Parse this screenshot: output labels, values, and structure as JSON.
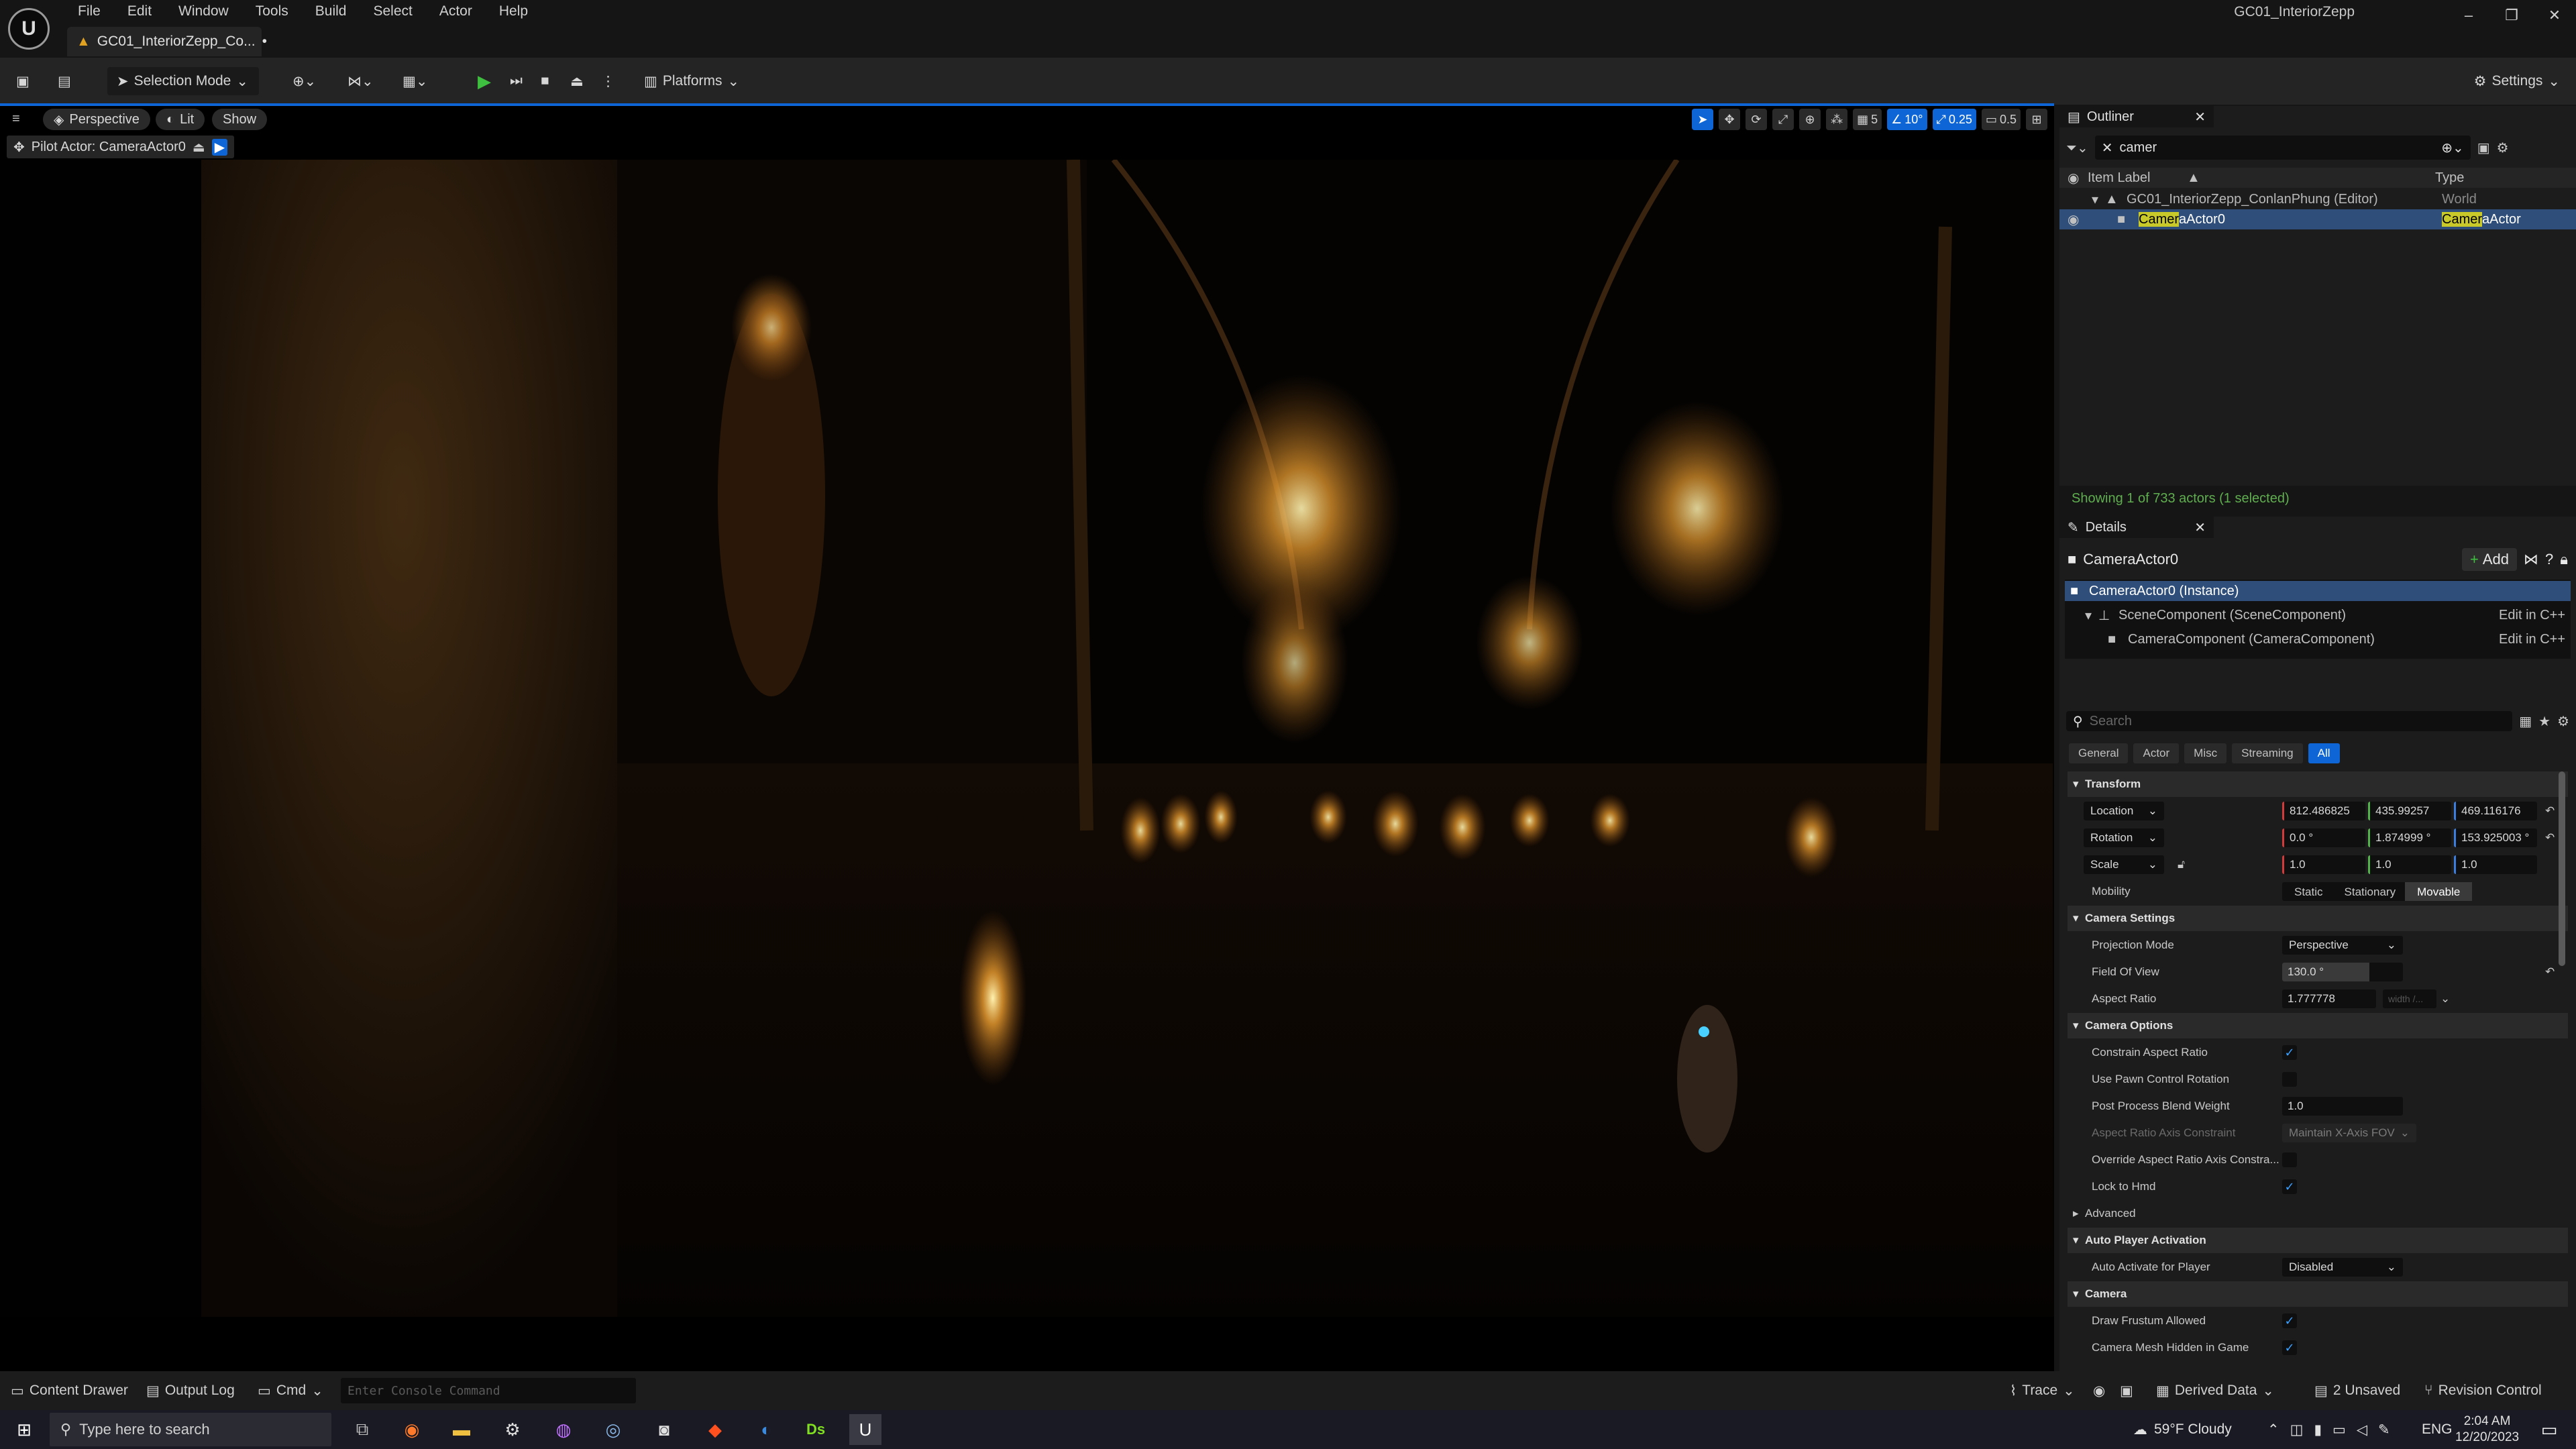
{
  "app": {
    "window_title": "GC01_InteriorZepp",
    "doc_tab": "GC01_InteriorZepp_Co...",
    "menus": [
      "File",
      "Edit",
      "Window",
      "Tools",
      "Build",
      "Select",
      "Actor",
      "Help"
    ]
  },
  "toolbar": {
    "selection_mode": "Selection Mode",
    "platforms": "Platforms",
    "settings": "Settings"
  },
  "viewport": {
    "perspective": "Perspective",
    "lit": "Lit",
    "show": "Show",
    "pilot_actor": "Pilot Actor: CameraActor0",
    "grid_snap": "5",
    "angle_snap": "10°",
    "scale_snap": "0.25",
    "camera_speed": "0.5"
  },
  "outliner": {
    "title": "Outliner",
    "search_value": "camer",
    "col_item_label": "Item Label",
    "col_type": "Type",
    "world_row": {
      "label": "GC01_InteriorZepp_ConlanPhung (Editor)",
      "type": "World"
    },
    "actor_row": {
      "label_hl": "Camer",
      "label_rest": "aActor0",
      "type_hl": "Camer",
      "type_rest": "aActor"
    },
    "status": "Showing 1 of 733 actors (1 selected)"
  },
  "details": {
    "title": "Details",
    "actor_name": "CameraActor0",
    "add_button": "Add",
    "components": [
      {
        "label": "CameraActor0 (Instance)",
        "edit": ""
      },
      {
        "label": "SceneComponent (SceneComponent)",
        "edit": "Edit in C++"
      },
      {
        "label": "CameraComponent (CameraComponent)",
        "edit": "Edit in C++"
      }
    ],
    "search_placeholder": "Search",
    "filter_tabs": [
      "General",
      "Actor",
      "Misc",
      "Streaming",
      "All"
    ],
    "transform": {
      "category": "Transform",
      "location_label": "Location",
      "location": [
        "812.486825",
        "435.99257",
        "469.116176"
      ],
      "rotation_label": "Rotation",
      "rotation": [
        "0.0 °",
        "1.874999 °",
        "153.925003 °"
      ],
      "scale_label": "Scale",
      "scale": [
        "1.0",
        "1.0",
        "1.0"
      ],
      "mobility_label": "Mobility",
      "mobility_options": [
        "Static",
        "Stationary",
        "Movable"
      ]
    },
    "camera_settings": {
      "category": "Camera Settings",
      "projection_mode_label": "Projection Mode",
      "projection_mode": "Perspective",
      "fov_label": "Field Of View",
      "fov": "130.0 °",
      "fov_fraction": 0.72,
      "aspect_ratio_label": "Aspect Ratio",
      "aspect_ratio": "1.777778",
      "aspect_ratio_hint": "width /..."
    },
    "camera_options": {
      "category": "Camera Options",
      "constrain_aspect": "Constrain Aspect Ratio",
      "use_pawn_rotation": "Use Pawn Control Rotation",
      "pp_blend_label": "Post Process Blend Weight",
      "pp_blend": "1.0",
      "axis_constraint_label": "Aspect Ratio Axis Constraint",
      "axis_constraint": "Maintain X-Axis FOV",
      "override_axis": "Override Aspect Ratio Axis Constra...",
      "lock_hmd": "Lock to Hmd",
      "advanced": "Advanced"
    },
    "auto_player": {
      "category": "Auto Player Activation",
      "label": "Auto Activate for Player",
      "value": "Disabled"
    },
    "camera": {
      "category": "Camera",
      "draw_frustum": "Draw Frustum Allowed",
      "mesh_hidden": "Camera Mesh Hidden in Game"
    }
  },
  "statusbar": {
    "content_drawer": "Content Drawer",
    "output_log": "Output Log",
    "cmd": "Cmd",
    "console_placeholder": "Enter Console Command",
    "trace": "Trace",
    "derived_data": "Derived Data",
    "unsaved": "2 Unsaved",
    "revision_control": "Revision Control"
  },
  "taskbar": {
    "search_placeholder": "Type here to search",
    "weather": "59°F  Cloudy",
    "lang": "ENG",
    "time": "2:04 AM",
    "date": "12/20/2023"
  },
  "colors": {
    "accent": "#0e66d6",
    "selection": "#2f4f7a",
    "highlight": "#c9c92a",
    "status_green": "#5fae4f"
  }
}
